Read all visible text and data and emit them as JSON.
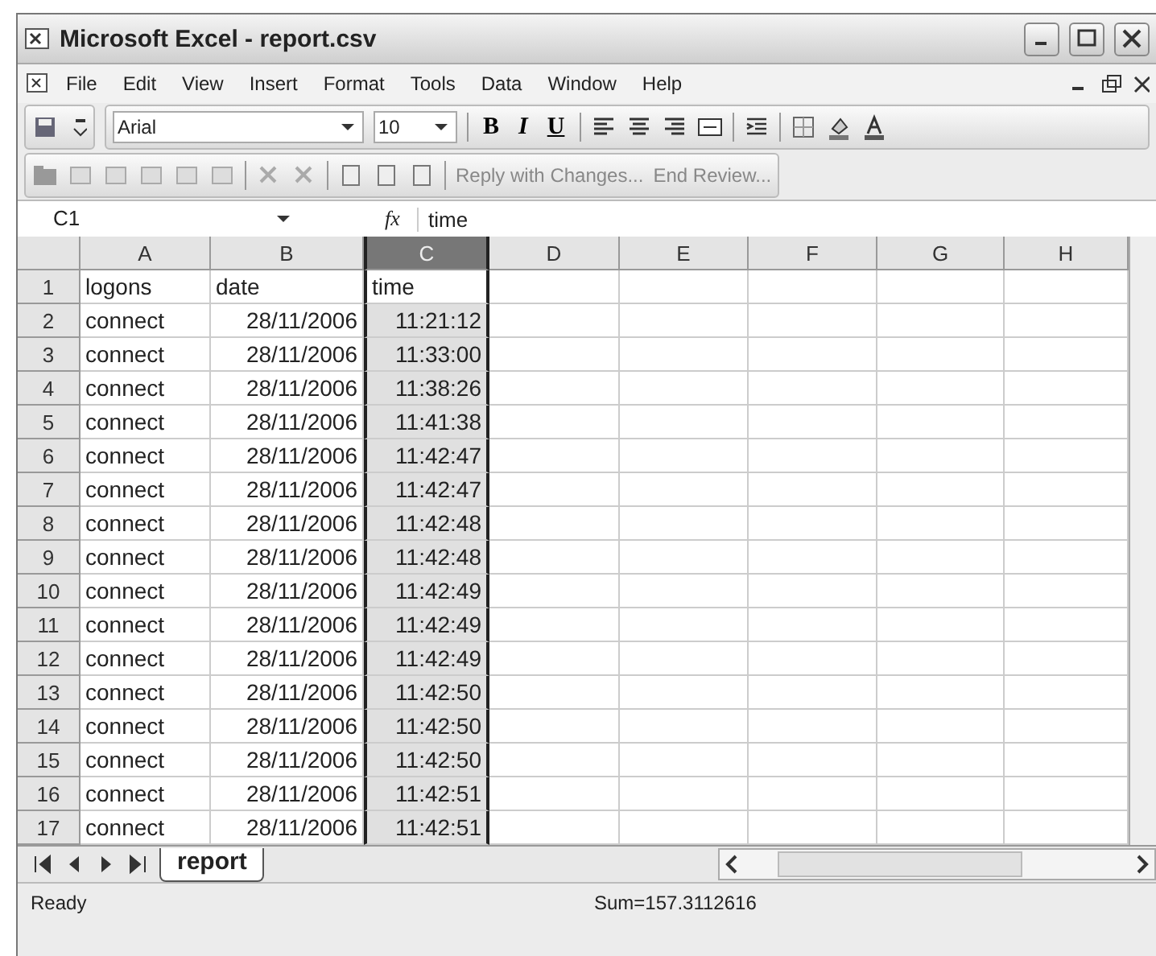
{
  "window": {
    "title": "Microsoft Excel - report.csv"
  },
  "menu": [
    "File",
    "Edit",
    "View",
    "Insert",
    "Format",
    "Tools",
    "Data",
    "Window",
    "Help"
  ],
  "formatting_toolbar": {
    "font": "Arial",
    "size": "10",
    "bold": "B",
    "italic": "I",
    "underline": "U"
  },
  "reviewing_toolbar": {
    "reply": "Reply with Changes...",
    "end_review": "End Review..."
  },
  "formula_bar": {
    "name_box": "C1",
    "fx": "fx",
    "value": "time"
  },
  "columns": [
    {
      "label": "A",
      "selected": false
    },
    {
      "label": "B",
      "selected": false
    },
    {
      "label": "C",
      "selected": true
    },
    {
      "label": "D",
      "selected": false
    },
    {
      "label": "E",
      "selected": false
    },
    {
      "label": "F",
      "selected": false
    },
    {
      "label": "G",
      "selected": false
    },
    {
      "label": "H",
      "selected": false
    }
  ],
  "rows": [
    {
      "number": "1",
      "cells": [
        {
          "text": "logons",
          "selected": false
        },
        {
          "text": "date",
          "selected": false
        },
        {
          "text": "time",
          "selected": true
        }
      ]
    },
    {
      "number": "2",
      "cells": [
        {
          "text": "connect",
          "selected": false
        },
        {
          "text": "28/11/2006",
          "selected": false
        },
        {
          "text": "11:21:12",
          "selected": false
        }
      ]
    },
    {
      "number": "3",
      "cells": [
        {
          "text": "connect",
          "selected": false
        },
        {
          "text": "28/11/2006",
          "selected": false
        },
        {
          "text": "11:33:00",
          "selected": false
        }
      ]
    },
    {
      "number": "4",
      "cells": [
        {
          "text": "connect",
          "selected": false
        },
        {
          "text": "28/11/2006",
          "selected": false
        },
        {
          "text": "11:38:26",
          "selected": false
        }
      ]
    },
    {
      "number": "5",
      "cells": [
        {
          "text": "connect",
          "selected": false
        },
        {
          "text": "28/11/2006",
          "selected": false
        },
        {
          "text": "11:41:38",
          "selected": false
        }
      ]
    },
    {
      "number": "6",
      "cells": [
        {
          "text": "connect",
          "selected": false
        },
        {
          "text": "28/11/2006",
          "selected": false
        },
        {
          "text": "11:42:47",
          "selected": false
        }
      ]
    },
    {
      "number": "7",
      "cells": [
        {
          "text": "connect",
          "selected": false
        },
        {
          "text": "28/11/2006",
          "selected": false
        },
        {
          "text": "11:42:47",
          "selected": false
        }
      ]
    },
    {
      "number": "8",
      "cells": [
        {
          "text": "connect",
          "selected": false
        },
        {
          "text": "28/11/2006",
          "selected": false
        },
        {
          "text": "11:42:48",
          "selected": false
        }
      ]
    },
    {
      "number": "9",
      "cells": [
        {
          "text": "connect",
          "selected": false
        },
        {
          "text": "28/11/2006",
          "selected": false
        },
        {
          "text": "11:42:48",
          "selected": false
        }
      ]
    },
    {
      "number": "10",
      "cells": [
        {
          "text": "connect",
          "selected": false
        },
        {
          "text": "28/11/2006",
          "selected": false
        },
        {
          "text": "11:42:49",
          "selected": false
        }
      ]
    },
    {
      "number": "11",
      "cells": [
        {
          "text": "connect",
          "selected": false
        },
        {
          "text": "28/11/2006",
          "selected": false
        },
        {
          "text": "11:42:49",
          "selected": false
        }
      ]
    },
    {
      "number": "12",
      "cells": [
        {
          "text": "connect",
          "selected": false
        },
        {
          "text": "28/11/2006",
          "selected": false
        },
        {
          "text": "11:42:49",
          "selected": false
        }
      ]
    },
    {
      "number": "13",
      "cells": [
        {
          "text": "connect",
          "selected": false
        },
        {
          "text": "28/11/2006",
          "selected": false
        },
        {
          "text": "11:42:50",
          "selected": false
        }
      ]
    },
    {
      "number": "14",
      "cells": [
        {
          "text": "connect",
          "selected": false
        },
        {
          "text": "28/11/2006",
          "selected": false
        },
        {
          "text": "11:42:50",
          "selected": false
        }
      ]
    },
    {
      "number": "15",
      "cells": [
        {
          "text": "connect",
          "selected": false
        },
        {
          "text": "28/11/2006",
          "selected": false
        },
        {
          "text": "11:42:50",
          "selected": false
        }
      ]
    },
    {
      "number": "16",
      "cells": [
        {
          "text": "connect",
          "selected": false
        },
        {
          "text": "28/11/2006",
          "selected": false
        },
        {
          "text": "11:42:51",
          "selected": false
        }
      ]
    },
    {
      "number": "17",
      "cells": [
        {
          "text": "connect",
          "selected": false
        },
        {
          "text": "28/11/2006",
          "selected": false
        },
        {
          "text": "11:42:51",
          "selected": false
        }
      ]
    }
  ],
  "sheet_tabs": [
    {
      "label": "report",
      "selected": true
    }
  ],
  "status_bar": {
    "status": "Ready",
    "sum": "Sum=157.3112616"
  }
}
